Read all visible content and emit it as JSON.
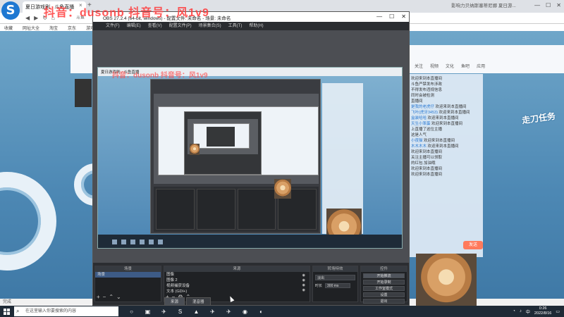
{
  "browser": {
    "tab_title": "夏日游戏刷 - 斗鱼直播",
    "search_hint": "影响力贝纳斯塞蒂尼娜 夏日游...",
    "url_hint": "斗鱼",
    "bookmarks": [
      "收藏",
      "网址大全",
      "淘宝",
      "京东",
      "游戏"
    ],
    "status_text": "完成"
  },
  "page": {
    "top_icons": [
      "关注",
      "视频",
      "文化",
      "鱼吧",
      "应用"
    ],
    "chat": [
      {
        "nick": "",
        "text": "欢迎来到本直播间"
      },
      {
        "nick": "",
        "text": "斗鱼严禁发布涉政"
      },
      {
        "nick": "",
        "text": "不得发布违规信息"
      },
      {
        "nick": "",
        "text": "同时会被检测"
      },
      {
        "nick": "",
        "text": "直播间"
      },
      {
        "nick": "是我的老虎仔",
        "text": "欢迎来到本直播间"
      },
      {
        "nick": "飞叶(虎牙3453)",
        "text": "欢迎来到本直播间"
      },
      {
        "nick": "盒装哈哈",
        "text": "欢迎来到本直播间"
      },
      {
        "nick": "天生小笨蛋",
        "text": "欢迎来到本直播间"
      },
      {
        "nick": "",
        "text": "上直播了这位主播"
      },
      {
        "nick": "",
        "text": "这是人气"
      },
      {
        "nick": "小夜猫",
        "text": "欢迎来到本直播间"
      },
      {
        "nick": "木木木木",
        "text": "欢迎来到本直播间"
      },
      {
        "nick": "",
        "text": "欢迎来到本直播间"
      },
      {
        "nick": "",
        "text": "关注主播可以领取"
      },
      {
        "nick": "",
        "text": "的红包 加油哦"
      },
      {
        "nick": "",
        "text": "欢迎来到本直播间"
      },
      {
        "nick": "",
        "text": "欢迎来到本直播间"
      }
    ],
    "send_button": "发送",
    "game_sign": "走刀任务"
  },
  "obs": {
    "title": "OBS 27.2.4 (64-bit, windows) - 配置文件: 未命名 - 场景: 未命名",
    "watermark": "抖音：dusonb 抖音号：风1v9",
    "menu": [
      "文件(F)",
      "编辑(E)",
      "查看(V)",
      "配置文件(P)",
      "场景集合(S)",
      "工具(T)",
      "帮助(H)"
    ],
    "docks": {
      "scenes": {
        "header": "场景",
        "items": [
          "场景"
        ]
      },
      "sources": {
        "header": "来源",
        "items": [
          "图像",
          "图像 2",
          "视频捕获设备",
          "文本 (GDI+)"
        ]
      },
      "transitions": {
        "header": "转场特效",
        "selected": "淡出",
        "duration_label": "时长",
        "duration_value": "300 ms"
      },
      "controls": {
        "header": "控件",
        "buttons": [
          "开始推流",
          "开始录制",
          "工作室模式",
          "设置",
          "退出"
        ]
      }
    },
    "tabs": [
      "来源",
      "混音器"
    ]
  },
  "taskbar": {
    "search_placeholder": "在这里输入你要搜索的内容",
    "time": "0:26",
    "date": "2022/8/16"
  }
}
